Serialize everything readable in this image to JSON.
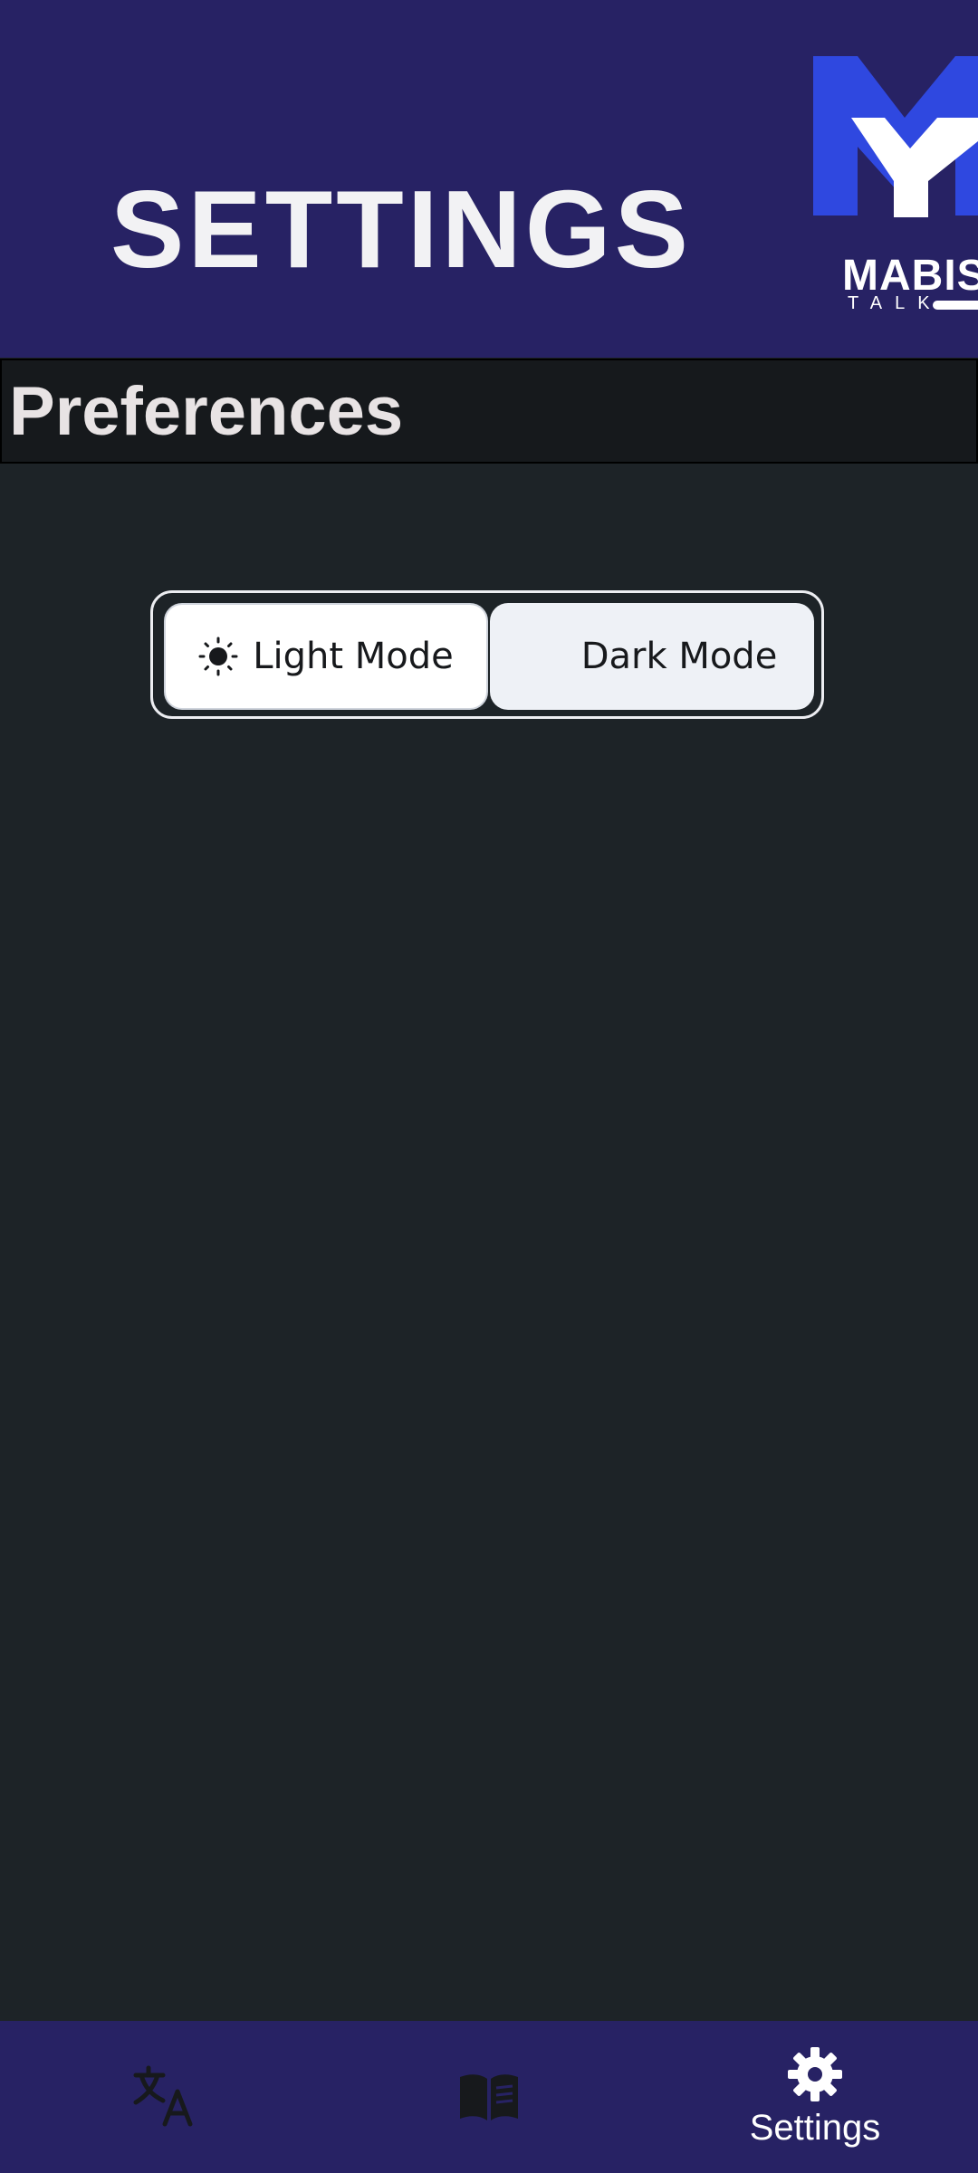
{
  "header": {
    "title": "SETTINGS",
    "logo_text": "MABISA",
    "logo_subtext": "TALK"
  },
  "section": {
    "title": "Preferences"
  },
  "theme_toggle": {
    "light_label": "Light Mode",
    "dark_label": "Dark Mode",
    "light_icon": "sun-icon",
    "dark_icon": "moon-icon"
  },
  "bottom_nav": {
    "items": [
      {
        "icon": "translate-icon",
        "label": ""
      },
      {
        "icon": "book-icon",
        "label": ""
      },
      {
        "icon": "gear-icon",
        "label": "Settings"
      }
    ]
  },
  "colors": {
    "header_bg": "#272264",
    "page_bg": "#1d2327",
    "section_bg": "#16191c",
    "logo_blue": "#2f48e0",
    "inactive_icon": "#17191c"
  }
}
